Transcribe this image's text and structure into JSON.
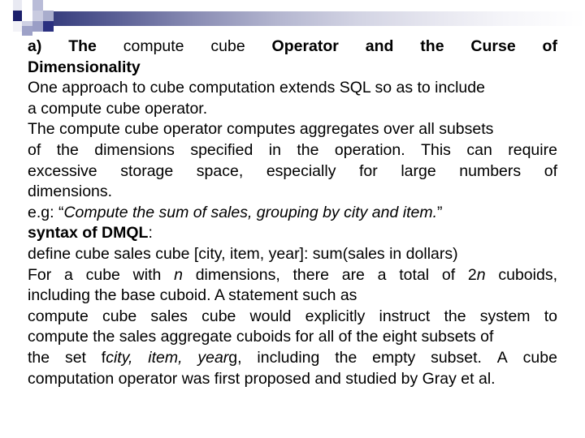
{
  "slide": {
    "decoration": {
      "gradient_bar": "navy-to-white-gradient",
      "accent_dark": "#1b1f6b",
      "accent_mid": "#9a9ec6",
      "accent_light": "#cfd1e4"
    },
    "heading": {
      "prefix": "a)",
      "w1": "The",
      "w2": "compute",
      "w3": "cube",
      "w4": "Operator",
      "w5": "and",
      "w6": "the",
      "w7": "Curse",
      "w8": "of",
      "line2": "Dimensionality"
    },
    "body": {
      "l1": "One approach to cube computation extends SQL so as to include",
      "l2": "a compute cube operator.",
      "l3": "The compute cube operator computes aggregates over all subsets",
      "l4": {
        "a": "of",
        "b": "the",
        "c": "dimensions",
        "d": "specified",
        "e": "in",
        "f": "the",
        "g": "operation.",
        "h": "This",
        "i": "can",
        "j": "require"
      },
      "l5": {
        "a": "excessive",
        "b": "storage",
        "c": "space,",
        "d": "especially",
        "e": "for",
        "f": "large",
        "g": "numbers",
        "h": "of"
      },
      "l6": "dimensions.",
      "l7_prefix": "e.g: “",
      "l7_italic": "Compute the sum of sales, grouping by city and item.",
      "l7_suffix": "”",
      "l8_bold": "syntax of DMQL",
      "l8_suffix": ":",
      "l9": "define cube sales cube [city, item, year]: sum(sales in dollars)",
      "l10": {
        "a": "For",
        "b": "a",
        "c": "cube",
        "d": "with",
        "e_italic": "n",
        "f": "dimensions,",
        "g": "there",
        "h": "are",
        "i": "a",
        "j": "total",
        "k": "of",
        "l_num": "2",
        "l_italic": "n",
        "m": "cuboids,"
      },
      "l11": "including the base cuboid. A statement such as",
      "l12": {
        "a": "compute",
        "b": "cube",
        "c": "sales",
        "d": "cube",
        "e": "would",
        "f": "explicitly",
        "g": "instruct",
        "h": "the",
        "i": "system",
        "j": "to"
      },
      "l13": "compute the sales aggregate cuboids for all of the eight subsets of",
      "l14": {
        "a": "the",
        "b": "set",
        "c": "f",
        "d_italic": "city,",
        "e_italic": "item,",
        "f_italic": "year",
        "g": "g,",
        "h": "including",
        "i": "the",
        "j": "empty",
        "k": "subset.",
        "l": "A",
        "m": "cube"
      },
      "l15": "computation operator was first proposed and studied by Gray et al."
    }
  }
}
